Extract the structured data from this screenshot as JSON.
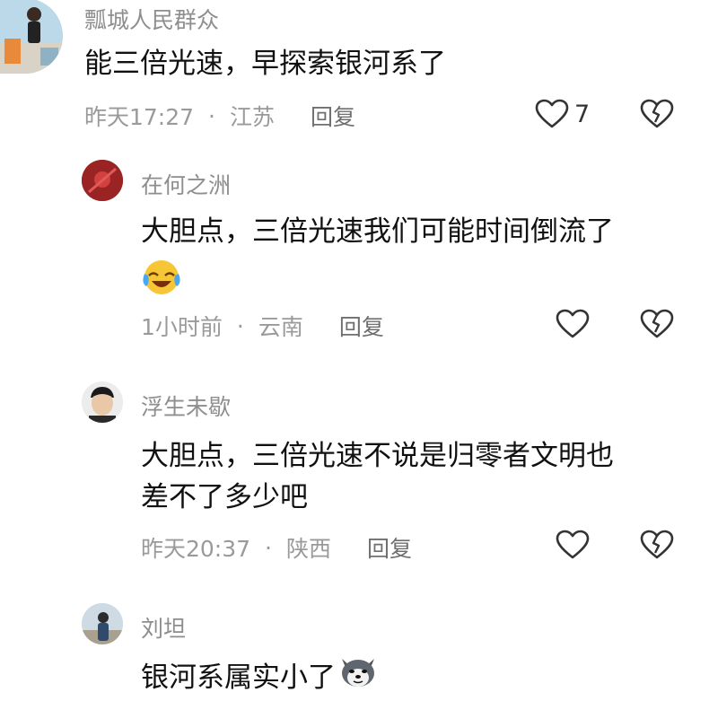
{
  "comments": [
    {
      "user": "瓢城人民群众",
      "text": "能三倍光速，早探索银河系了",
      "time": "昨天17:27",
      "location": "江苏",
      "reply": "回复",
      "likes": "7",
      "icons": {
        "like": "heart-outline-icon",
        "dislike": "broken-heart-icon"
      }
    },
    {
      "user": "在何之洲",
      "text": "大胆点，三倍光速我们可能时间倒流了",
      "emoji": "laughing-crying-emoji",
      "time": "1小时前",
      "location": "云南",
      "reply": "回复"
    },
    {
      "user": "浮生未歇",
      "text_line1": "大胆点，三倍光速不说是归零者文明也",
      "text_line2": "差不了多少吧",
      "time": "昨天20:37",
      "location": "陕西",
      "reply": "回复"
    },
    {
      "user": "刘坦",
      "text": "银河系属实小了",
      "emoji": "husky-dog-emoji"
    }
  ],
  "separator": "·",
  "colors": {
    "meta": "#9a9a9a",
    "username": "#8e8e8e",
    "text": "#111111"
  }
}
